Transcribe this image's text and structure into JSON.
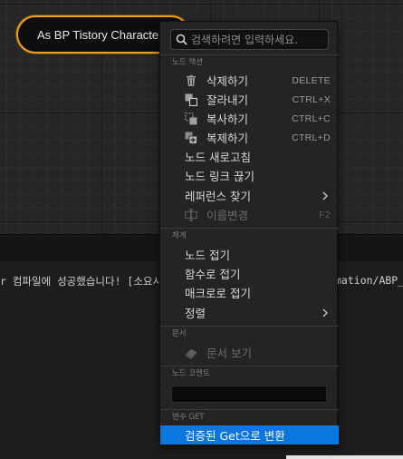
{
  "graph": {
    "node_title": "As BP Tistory Character"
  },
  "log": {
    "line_left": "r 컴파일에 성공했습니다! [소요시",
    "line_right": "mation/ABP_"
  },
  "menu": {
    "search_placeholder": "검색하려면 입력하세요.",
    "sections": {
      "node_actions": "노드 액션",
      "organization": "체계",
      "documentation": "문서",
      "node_comment": "노드 코멘트",
      "variable_get": "변수 GET"
    },
    "items": {
      "delete": {
        "label": "삭제하기",
        "shortcut": "DELETE",
        "icon": "trash-icon"
      },
      "cut": {
        "label": "잘라내기",
        "shortcut": "CTRL+X",
        "icon": "cut-icon"
      },
      "copy": {
        "label": "복사하기",
        "shortcut": "CTRL+C",
        "icon": "copy-icon"
      },
      "duplicate": {
        "label": "복제하기",
        "shortcut": "CTRL+D",
        "icon": "duplicate-icon"
      },
      "refresh_nodes": {
        "label": "노드 새로고침"
      },
      "break_links": {
        "label": "노드 링크 끊기"
      },
      "find_references": {
        "label": "레퍼런스 찾기"
      },
      "rename": {
        "label": "이름변경",
        "shortcut": "F2",
        "icon": "rename-icon"
      },
      "collapse_nodes": {
        "label": "노드 접기"
      },
      "collapse_to_function": {
        "label": "함수로 접기"
      },
      "collapse_to_macro": {
        "label": "매크로로 접기"
      },
      "alignment": {
        "label": "정렬"
      },
      "view_documentation": {
        "label": "문서 보기",
        "icon": "book-icon"
      },
      "convert_to_validated_get": {
        "label": "검증된 Get으로 변환"
      }
    },
    "comment_value": ""
  },
  "colors": {
    "node_border": "#f0a020",
    "pin": "#4aa6e6",
    "highlight": "#0a76e0"
  }
}
